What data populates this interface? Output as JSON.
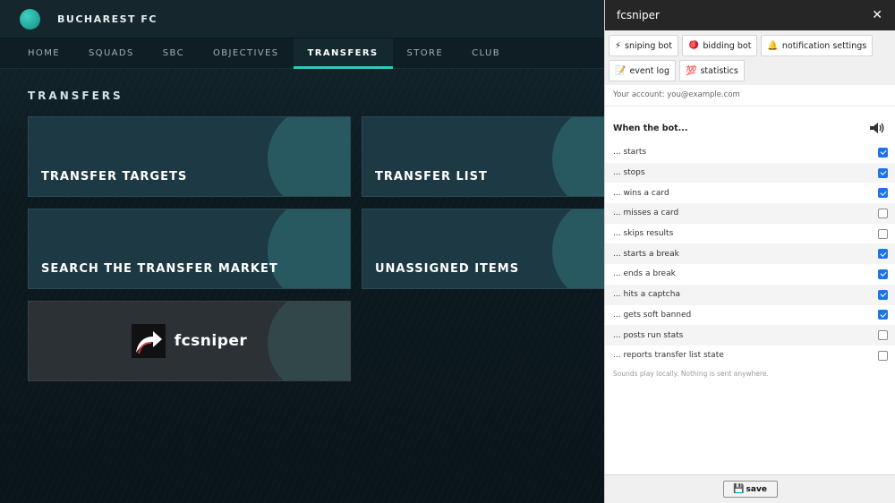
{
  "app": {
    "club_name": "BUCHAREST FC",
    "nav": [
      "HOME",
      "SQUADS",
      "SBC",
      "OBJECTIVES",
      "TRANSFERS",
      "STORE",
      "CLUB"
    ],
    "active_nav": "TRANSFERS",
    "section_title": "TRANSFERS",
    "tiles": {
      "transfer_targets": "TRANSFER TARGETS",
      "transfer_list": "TRANSFER LIST",
      "search_market": "SEARCH THE TRANSFER MARKET",
      "unassigned": "UNASSIGNED ITEMS",
      "brand": "fcsniper"
    },
    "colors": {
      "accent": "#2fc7bb",
      "tile": "#1d3a44"
    }
  },
  "panel": {
    "title": "fcsniper",
    "close_label": "✕",
    "tabs": [
      {
        "icon": "⚡",
        "icon_name": "lightning-icon",
        "label": "sniping bot"
      },
      {
        "icon": "🪀",
        "icon_name": "yoyo-icon",
        "label": "bidding bot"
      },
      {
        "icon": "🔔",
        "icon_name": "bell-icon",
        "label": "notification settings"
      },
      {
        "icon": "📝",
        "icon_name": "memo-icon",
        "label": "event log"
      },
      {
        "icon": "💯",
        "icon_name": "hundred-icon",
        "label": "statistics"
      }
    ],
    "account_text": "Your account: you@example.com",
    "list_header": "When the bot...",
    "header_icon": "speaker-icon",
    "events": [
      {
        "label": "... starts",
        "checked": true
      },
      {
        "label": "... stops",
        "checked": true
      },
      {
        "label": "... wins a card",
        "checked": true
      },
      {
        "label": "... misses a card",
        "checked": false
      },
      {
        "label": "... skips results",
        "checked": false
      },
      {
        "label": "... starts a break",
        "checked": true
      },
      {
        "label": "... ends a break",
        "checked": true
      },
      {
        "label": "... hits a captcha",
        "checked": true
      },
      {
        "label": "... gets soft banned",
        "checked": true
      },
      {
        "label": "... posts run stats",
        "checked": false
      },
      {
        "label": "... reports transfer list state",
        "checked": false
      }
    ],
    "note": "Sounds play locally. Nothing is sent anywhere.",
    "save": {
      "icon": "💾",
      "icon_name": "floppy-disk-icon",
      "label": "save"
    },
    "colors": {
      "checkbox": "#1f73e8",
      "header": "#262626"
    }
  }
}
